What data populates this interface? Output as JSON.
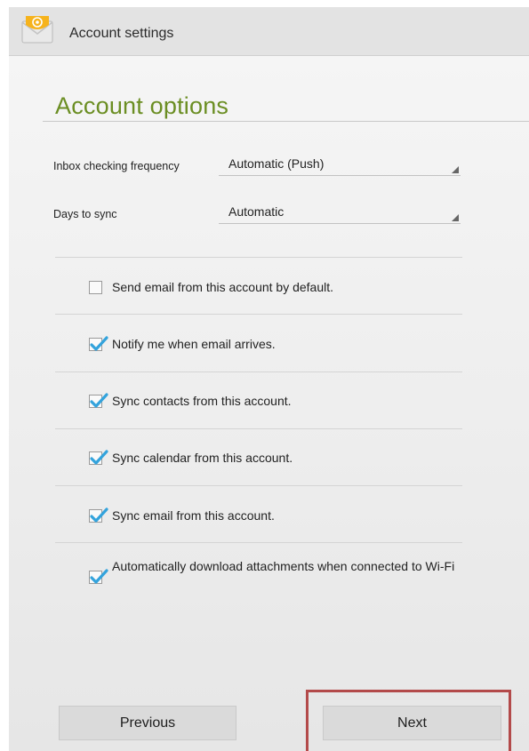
{
  "action_bar": {
    "title": "Account settings",
    "icon": "email-app-icon"
  },
  "section_title": "Account options",
  "fields": {
    "inbox_frequency": {
      "label": "Inbox checking frequency",
      "value": "Automatic (Push)"
    },
    "days_to_sync": {
      "label": "Days to sync",
      "value": "Automatic"
    }
  },
  "options": [
    {
      "label": "Send email from this account by default.",
      "checked": false
    },
    {
      "label": "Notify me when email arrives.",
      "checked": true
    },
    {
      "label": "Sync contacts from this account.",
      "checked": true
    },
    {
      "label": "Sync calendar from this account.",
      "checked": true
    },
    {
      "label": "Sync email from this account.",
      "checked": true
    },
    {
      "label": "Automatically download attachments when connected to Wi-Fi",
      "checked": true
    }
  ],
  "buttons": {
    "previous": "Previous",
    "next": "Next"
  },
  "colors": {
    "section_title": "#6b8e23",
    "checkmark": "#33a3dc",
    "highlight": "#b34a4a"
  }
}
